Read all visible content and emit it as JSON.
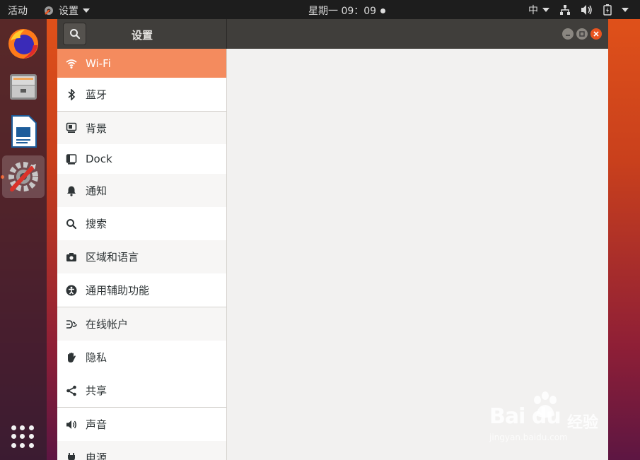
{
  "topbar": {
    "activities": "活动",
    "app_menu": "设置",
    "clock": "星期一 09：09",
    "input_method": "中"
  },
  "dock": {
    "items": [
      {
        "name": "firefox"
      },
      {
        "name": "files"
      },
      {
        "name": "libreoffice-writer"
      },
      {
        "name": "settings",
        "active": true
      }
    ]
  },
  "window": {
    "title": "设置",
    "sidebar": [
      {
        "label": "Wi-Fi",
        "icon": "wifi-icon",
        "selected": true
      },
      {
        "label": "蓝牙",
        "icon": "bluetooth-icon"
      },
      {
        "label": "背景",
        "icon": "background-icon"
      },
      {
        "label": "Dock",
        "icon": "dock-icon"
      },
      {
        "label": "通知",
        "icon": "bell-icon"
      },
      {
        "label": "搜索",
        "icon": "search-icon"
      },
      {
        "label": "区域和语言",
        "icon": "camera-icon"
      },
      {
        "label": "通用辅助功能",
        "icon": "accessibility-icon"
      },
      {
        "label": "在线帐户",
        "icon": "online-accounts-icon"
      },
      {
        "label": "隐私",
        "icon": "hand-icon"
      },
      {
        "label": "共享",
        "icon": "share-icon"
      },
      {
        "label": "声音",
        "icon": "speaker-icon"
      },
      {
        "label": "电源",
        "icon": "power-icon"
      }
    ]
  },
  "watermark": {
    "brand": "Bai du",
    "right": "经验",
    "url": "jingyan.baidu.com"
  },
  "colors": {
    "accent": "#e95420",
    "selected_row": "#f48b5e",
    "titlebar": "#403e3b",
    "topbar": "#1d1d1d"
  }
}
